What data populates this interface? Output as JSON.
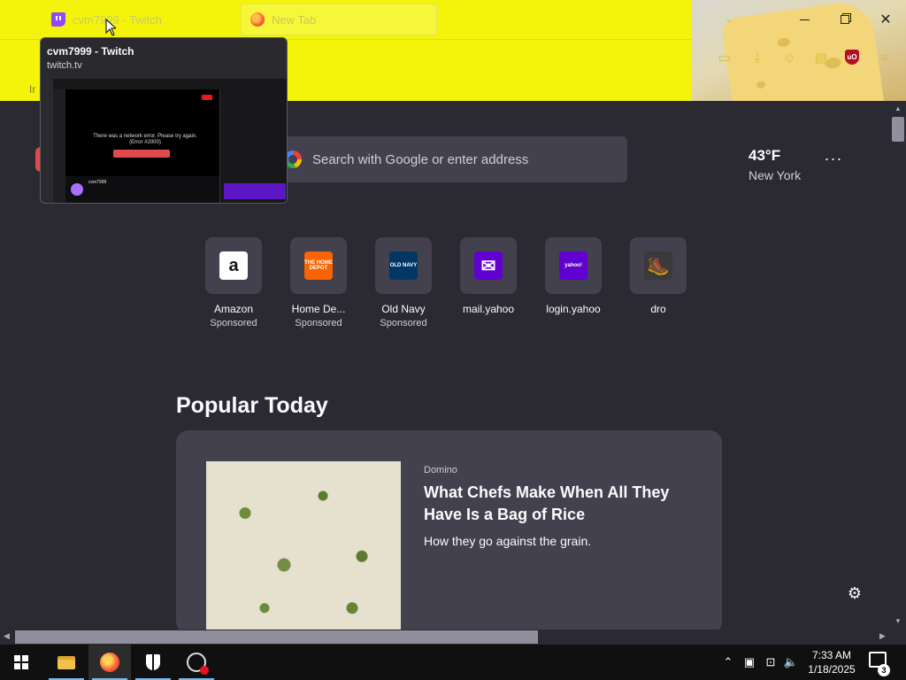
{
  "tabs": [
    {
      "title": "cvm7999 - Twitch",
      "favicon": "twitch-icon"
    },
    {
      "title": "New Tab",
      "favicon": "firefox-icon"
    }
  ],
  "tab_preview": {
    "title": "cvm7999 - Twitch",
    "url": "twitch.tv"
  },
  "preview_shot": {
    "error_text": "There was a network error. Please try again. (Error #2000)",
    "channel": "cvm7999"
  },
  "bookmarks_toolbar": {
    "partial_text": "Ir"
  },
  "search": {
    "placeholder": "Search with Google or enter address"
  },
  "weather": {
    "temperature": "43°F",
    "location": "New York"
  },
  "shortcuts": [
    {
      "label": "Amazon",
      "sub": "Sponsored",
      "logo": "a",
      "bg": "#ffffff",
      "fg": "#111111"
    },
    {
      "label": "Home De...",
      "sub": "Sponsored",
      "logo": "THE HOME DEPOT",
      "bg": "#f96302",
      "fg": "#ffffff"
    },
    {
      "label": "Old Navy",
      "sub": "Sponsored",
      "logo": "OLD NAVY",
      "bg": "#003764",
      "fg": "#ffffff"
    },
    {
      "label": "mail.yahoo",
      "sub": "",
      "logo": "✉",
      "bg": "#6001d2",
      "fg": "#ffffff"
    },
    {
      "label": "login.yahoo",
      "sub": "",
      "logo": "yahoo!",
      "bg": "#6001d2",
      "fg": "#ffffff"
    },
    {
      "label": "dro",
      "sub": "",
      "logo": "🥾",
      "bg": "#3a3a3a",
      "fg": "#c9a24a"
    }
  ],
  "popular": {
    "title": "Popular Today",
    "card": {
      "source": "Domino",
      "headline": "What Chefs Make When All They Have Is a Bag of Rice",
      "excerpt": "How they go against the grain."
    }
  },
  "taskbar": {
    "time": "7:33 AM",
    "date": "1/18/2025",
    "notifications": "3"
  },
  "colors": {
    "theme_yellow": "#f4f40a",
    "page_bg": "#2b2a33",
    "card_bg": "#42414d"
  }
}
